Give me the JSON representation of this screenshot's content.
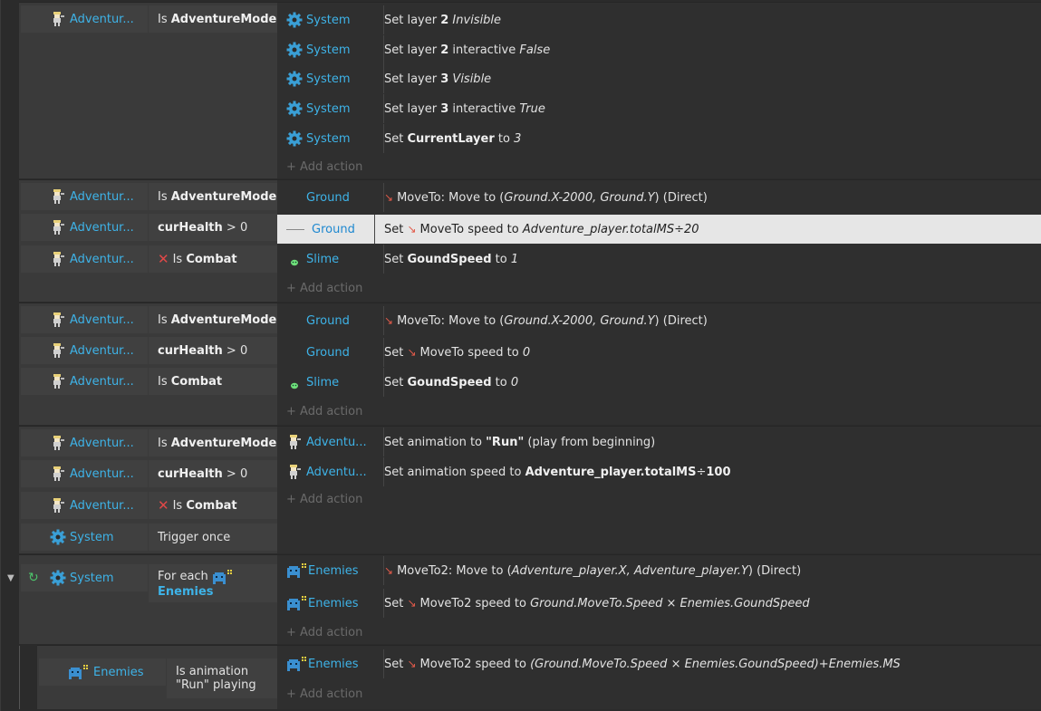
{
  "add_action_label": "+ Add action",
  "events": [
    {
      "conditions": [
        {
          "object": "Adventur...",
          "icon": "player-sprite-icon",
          "parts": [
            {
              "t": "Is "
            },
            {
              "t": "AdventureMode",
              "b": true
            }
          ]
        }
      ],
      "actions": [
        {
          "object": "System",
          "icon": "gear-icon",
          "parts": [
            {
              "t": "Set layer "
            },
            {
              "t": "2",
              "b": true
            },
            {
              "t": " "
            },
            {
              "t": "Invisible",
              "i": true
            }
          ]
        },
        {
          "object": "System",
          "icon": "gear-icon",
          "parts": [
            {
              "t": "Set layer "
            },
            {
              "t": "2",
              "b": true
            },
            {
              "t": " interactive "
            },
            {
              "t": "False",
              "i": true
            }
          ]
        },
        {
          "object": "System",
          "icon": "gear-icon",
          "parts": [
            {
              "t": "Set layer "
            },
            {
              "t": "3",
              "b": true
            },
            {
              "t": " "
            },
            {
              "t": "Visible",
              "i": true
            }
          ]
        },
        {
          "object": "System",
          "icon": "gear-icon",
          "parts": [
            {
              "t": "Set layer "
            },
            {
              "t": "3",
              "b": true
            },
            {
              "t": " interactive "
            },
            {
              "t": "True",
              "i": true
            }
          ]
        },
        {
          "object": "System",
          "icon": "gear-icon",
          "parts": [
            {
              "t": "Set "
            },
            {
              "t": "CurrentLayer",
              "b": true
            },
            {
              "t": " to "
            },
            {
              "t": "3",
              "i": true
            }
          ]
        }
      ]
    },
    {
      "conditions": [
        {
          "object": "Adventur...",
          "icon": "player-sprite-icon",
          "parts": [
            {
              "t": "Is "
            },
            {
              "t": "AdventureMode",
              "b": true
            }
          ]
        },
        {
          "object": "Adventur...",
          "icon": "player-sprite-icon",
          "parts": [
            {
              "t": "curHealth",
              "b": true
            },
            {
              "t": " > 0"
            }
          ]
        },
        {
          "object": "Adventur...",
          "icon": "player-sprite-icon",
          "inverted": true,
          "parts": [
            {
              "t": "Is "
            },
            {
              "t": "Combat",
              "b": true
            }
          ]
        }
      ],
      "actions": [
        {
          "object": "Ground",
          "icon": "none",
          "parts": [
            {
              "t": "MoveTo: Move to (",
              "mi": true
            },
            {
              "t": "Ground.X-2000, Ground.Y",
              "i": true
            },
            {
              "t": ") (Direct)"
            }
          ]
        },
        {
          "object": "Ground",
          "icon": "dash",
          "selected": true,
          "parts": [
            {
              "t": "Set "
            },
            {
              "t": "MoveTo speed to ",
              "mi": true
            },
            {
              "t": "Adventure_player.totalMS÷20",
              "i": true
            }
          ]
        },
        {
          "object": "Slime",
          "icon": "slime-icon",
          "parts": [
            {
              "t": "Set "
            },
            {
              "t": "GoundSpeed",
              "b": true
            },
            {
              "t": " to "
            },
            {
              "t": "1",
              "i": true
            }
          ]
        }
      ]
    },
    {
      "conditions": [
        {
          "object": "Adventur...",
          "icon": "player-sprite-icon",
          "parts": [
            {
              "t": "Is "
            },
            {
              "t": "AdventureMode",
              "b": true
            }
          ]
        },
        {
          "object": "Adventur...",
          "icon": "player-sprite-icon",
          "parts": [
            {
              "t": "curHealth",
              "b": true
            },
            {
              "t": " > 0"
            }
          ]
        },
        {
          "object": "Adventur...",
          "icon": "player-sprite-icon",
          "parts": [
            {
              "t": "Is "
            },
            {
              "t": "Combat",
              "b": true
            }
          ]
        }
      ],
      "actions": [
        {
          "object": "Ground",
          "icon": "none",
          "parts": [
            {
              "t": "MoveTo: Move to (",
              "mi": true
            },
            {
              "t": "Ground.X-2000, Ground.Y",
              "i": true
            },
            {
              "t": ") (Direct)"
            }
          ]
        },
        {
          "object": "Ground",
          "icon": "none",
          "parts": [
            {
              "t": "Set "
            },
            {
              "t": "MoveTo speed to ",
              "mi": true
            },
            {
              "t": "0",
              "i": true
            }
          ]
        },
        {
          "object": "Slime",
          "icon": "slime-icon",
          "parts": [
            {
              "t": "Set "
            },
            {
              "t": "GoundSpeed",
              "b": true
            },
            {
              "t": " to "
            },
            {
              "t": "0",
              "i": true
            }
          ]
        }
      ]
    },
    {
      "conditions": [
        {
          "object": "Adventur...",
          "icon": "player-sprite-icon",
          "parts": [
            {
              "t": "Is "
            },
            {
              "t": "AdventureMode",
              "b": true
            }
          ]
        },
        {
          "object": "Adventur...",
          "icon": "player-sprite-icon",
          "parts": [
            {
              "t": "curHealth",
              "b": true
            },
            {
              "t": " > 0"
            }
          ]
        },
        {
          "object": "Adventur...",
          "icon": "player-sprite-icon",
          "inverted": true,
          "parts": [
            {
              "t": "Is "
            },
            {
              "t": "Combat",
              "b": true
            }
          ]
        },
        {
          "object": "System",
          "icon": "gear-icon",
          "parts": [
            {
              "t": "Trigger once"
            }
          ]
        }
      ],
      "actions": [
        {
          "object": "Adventu...",
          "icon": "player-sprite-icon",
          "parts": [
            {
              "t": "Set animation to "
            },
            {
              "t": "\"Run\"",
              "b": true
            },
            {
              "t": " (play from beginning)"
            }
          ]
        },
        {
          "object": "Adventu...",
          "icon": "player-sprite-icon",
          "parts": [
            {
              "t": "Set animation speed to "
            },
            {
              "t": "Adventure_player.totalMS",
              "b": true
            },
            {
              "t": "÷"
            },
            {
              "t": "100",
              "b": true
            }
          ]
        }
      ]
    },
    {
      "conditions": [
        {
          "object": "System",
          "icon": "gear-icon",
          "parts": [
            {
              "t": "For each "
            },
            {
              "t": "Enemies",
              "obj": true
            }
          ]
        }
      ],
      "actions": [
        {
          "object": "Enemies",
          "icon": "enemies-icon",
          "parts": [
            {
              "t": "MoveTo2: Move to (",
              "mi": true
            },
            {
              "t": "Adventure_player.X, Adventure_player.Y",
              "i": true
            },
            {
              "t": ") (Direct)"
            }
          ]
        },
        {
          "object": "Enemies",
          "icon": "enemies-icon",
          "parts": [
            {
              "t": "Set "
            },
            {
              "t": "MoveTo2 speed to ",
              "mi": true
            },
            {
              "t": "Ground.MoveTo.Speed × Enemies.GoundSpeed",
              "i": true
            }
          ]
        }
      ]
    },
    {
      "conditions": [
        {
          "object": "Enemies",
          "icon": "enemies-icon",
          "parts": [
            {
              "t": "Is animation"
            },
            {
              "t": "\"Run\" playing"
            }
          ]
        }
      ],
      "actions": [
        {
          "object": "Enemies",
          "icon": "enemies-icon",
          "parts": [
            {
              "t": "Set "
            },
            {
              "t": "MoveTo2 speed to ",
              "mi": true
            },
            {
              "t": "(Ground.MoveTo.Speed × Enemies.GoundSpeed)+Enemies.MS",
              "i": true
            }
          ]
        }
      ]
    }
  ]
}
